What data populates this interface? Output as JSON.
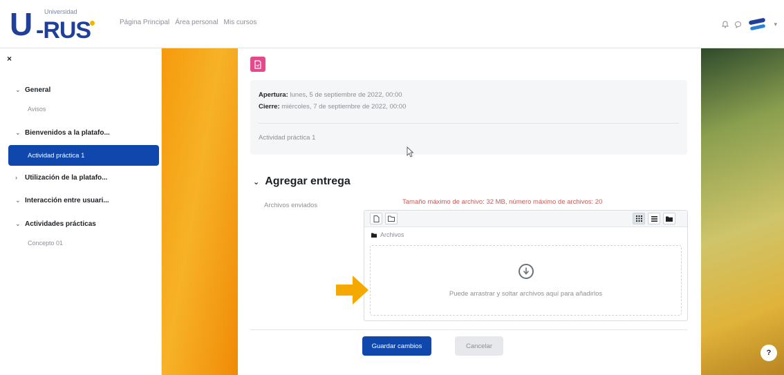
{
  "brand": {
    "logo_small": "Universidad",
    "logo_main_u": "U",
    "logo_main_rus": "-RUS",
    "accent": "#1f3f99",
    "dot": "#f1b400"
  },
  "topnav": {
    "links": [
      "Página Principal",
      "Área personal",
      "Mis cursos"
    ]
  },
  "sidebar": {
    "close_icon": "×",
    "items": [
      {
        "label": "General",
        "type": "section",
        "chevron": "⌄"
      },
      {
        "label": "Avisos",
        "type": "sub"
      },
      {
        "label": "Bienvenidos a la platafo...",
        "type": "section",
        "chevron": "⌄"
      },
      {
        "label": "Actividad práctica 1",
        "type": "active"
      },
      {
        "label": "Utilización de la platafo...",
        "type": "section",
        "chevron": "›"
      },
      {
        "label": "Interacción entre usuari...",
        "type": "section",
        "chevron": "⌄"
      },
      {
        "label": "Actividades prácticas",
        "type": "section",
        "chevron": "⌄"
      },
      {
        "label": "Concepto 01",
        "type": "sub"
      }
    ]
  },
  "assignment": {
    "opening_label": "Apertura:",
    "opening_value": "lunes, 5 de septiembre de 2022, 00:00",
    "closing_label": "Cierre:",
    "closing_value": "miércoles, 7 de septiembre de 2022, 00:00",
    "description": "Actividad práctica 1"
  },
  "submission": {
    "section_title": "Agregar entrega",
    "files_label": "Archivos enviados",
    "limits_text": "Tamaño máximo de archivo: 32 MB, número máximo de archivos: 20",
    "breadcrumb": "Archivos",
    "drop_text": "Puede arrastrar y soltar archivos aquí para añadirlos"
  },
  "buttons": {
    "save": "Guardar cambios",
    "cancel": "Cancelar"
  },
  "help_icon": "?"
}
